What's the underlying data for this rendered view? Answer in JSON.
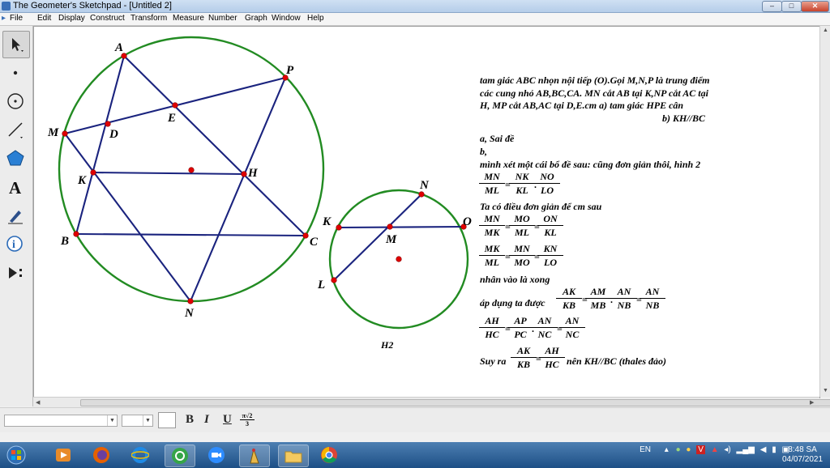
{
  "window": {
    "title": "The Geometer's Sketchpad - [Untitled 2]",
    "controls": [
      "–",
      "□",
      "✕"
    ],
    "doc_controls": [
      "_",
      "▫",
      "×"
    ]
  },
  "menu": [
    "File",
    "Edit",
    "Display",
    "Construct",
    "Transform",
    "Measure",
    "Number",
    "Graph",
    "Window",
    "Help"
  ],
  "tools": [
    "selection-arrow-tool",
    "point-tool",
    "compass-tool",
    "straightedge-tool",
    "polygon-tool",
    "text-tool",
    "marker-tool",
    "information-tool",
    "custom-tool"
  ],
  "figure1": {
    "labels": {
      "A": "A",
      "P": "P",
      "E": "E",
      "M": "M",
      "D": "D",
      "K": "K",
      "H": "H",
      "B": "B",
      "C": "C",
      "N": "N"
    }
  },
  "figure2": {
    "labels": {
      "N": "N",
      "K": "K",
      "O": "O",
      "M": "M",
      "L": "L"
    },
    "caption": "H2"
  },
  "notes": {
    "problem_l1": "tam giác ABC nhọn nội tiếp (O).Gọi M,N,P là trung điểm",
    "problem_l2": "các cung nhỏ AB,BC,CA. MN cắt AB tại K,NP cắt AC tại",
    "problem_l3": "H, MP cắt AB,AC tại D,E.cm a) tam giác HPE cân",
    "problem_l4": "b) KH//BC",
    "a": "a, Sai đề",
    "b": "b,",
    "lemma": "mình xét một cái bổ đề sau: cũng đơn giản thôi, hình 2",
    "eq1": [
      {
        "n": "MN",
        "d": "ML"
      },
      {
        "n": "NK",
        "d": "KL"
      },
      {
        "n": "NO",
        "d": "LO"
      }
    ],
    "easy": "Ta có điều đơn giản để cm sau",
    "eq2": [
      {
        "n": "MN",
        "d": "MK"
      },
      {
        "n": "MO",
        "d": "ML"
      },
      {
        "n": "ON",
        "d": "KL"
      }
    ],
    "eq3": [
      {
        "n": "MK",
        "d": "ML"
      },
      {
        "n": "MN",
        "d": "MO"
      },
      {
        "n": "KN",
        "d": "LO"
      }
    ],
    "multiply": "nhân vào là xong",
    "apply": "áp dụng ta được",
    "eq4": [
      {
        "n": "AK",
        "d": "KB"
      },
      {
        "n": "AM",
        "d": "MB"
      },
      {
        "n": "AN",
        "d": "NB"
      },
      {
        "n": "AN",
        "d": "NB"
      }
    ],
    "eq5": [
      {
        "n": "AH",
        "d": "HC"
      },
      {
        "n": "AP",
        "d": "PC"
      },
      {
        "n": "AN",
        "d": "NC"
      },
      {
        "n": "AN",
        "d": "NC"
      }
    ],
    "conclude_prefix": "Suy ra",
    "eq6": [
      {
        "n": "AK",
        "d": "KB"
      },
      {
        "n": "AH",
        "d": "HC"
      }
    ],
    "conclude_suffix": "nên KH//BC (thales đảo)",
    "ops": {
      "eq": "=",
      "dot": "."
    }
  },
  "text_toolbar": {
    "bold": "B",
    "italic": "I",
    "underline": "U",
    "symbol_n": "π√2",
    "symbol_d": "3"
  },
  "taskbar": {
    "language": "EN",
    "time": "8:48 SA",
    "date": "04/07/2021"
  },
  "colors": {
    "circle": "#228b22",
    "segment": "#1a237e",
    "point": "#e00000",
    "taskbar": "#1d4f86"
  }
}
